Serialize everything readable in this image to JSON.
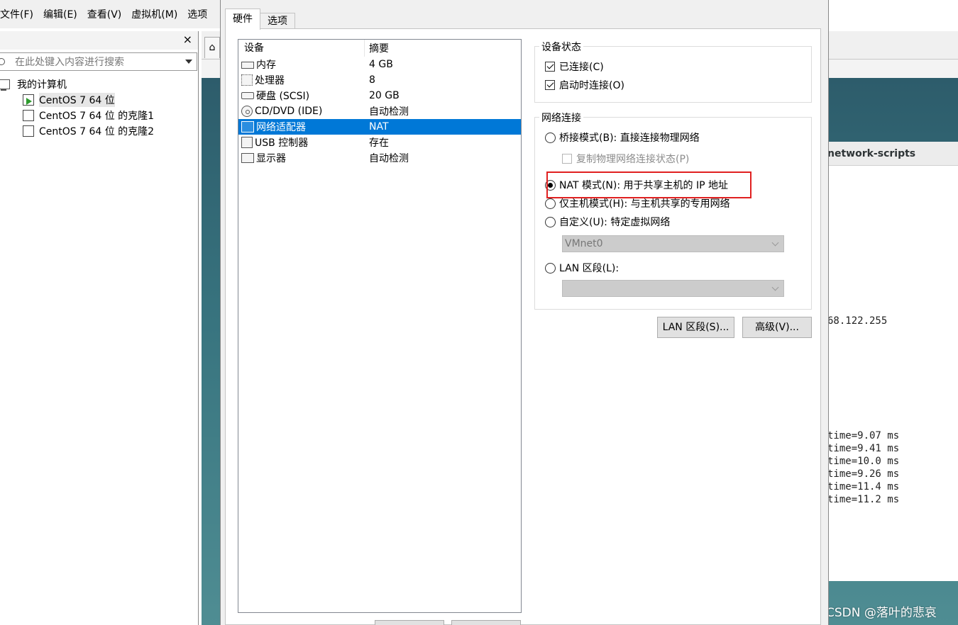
{
  "menubar": {
    "items": [
      "文件(F)",
      "编辑(E)",
      "查看(V)",
      "虚拟机(M)",
      "选项"
    ]
  },
  "library": {
    "close_label": "×",
    "search_placeholder": "在此处键入内容进行搜索",
    "root": "我的计算机",
    "vms": [
      "CentOS 7 64 位",
      "CentOS 7 64 位 的克隆1",
      "CentOS 7 64 位 的克隆2"
    ]
  },
  "dialog": {
    "tabs": [
      "硬件",
      "选项"
    ],
    "device_columns": [
      "设备",
      "摘要"
    ],
    "devices": [
      {
        "name": "内存",
        "summary": "4 GB",
        "icon": "memory-icon"
      },
      {
        "name": "处理器",
        "summary": "8",
        "icon": "cpu-icon"
      },
      {
        "name": "硬盘 (SCSI)",
        "summary": "20 GB",
        "icon": "hard-disk-icon"
      },
      {
        "name": "CD/DVD (IDE)",
        "summary": "自动检测",
        "icon": "cd-dvd-icon"
      },
      {
        "name": "网络适配器",
        "summary": "NAT",
        "icon": "network-adapter-icon"
      },
      {
        "name": "USB 控制器",
        "summary": "存在",
        "icon": "usb-icon"
      },
      {
        "name": "显示器",
        "summary": "自动检测",
        "icon": "display-icon"
      }
    ],
    "device_status": {
      "title": "设备状态",
      "connected": "已连接(C)",
      "connect_on_power": "启动时连接(O)"
    },
    "network": {
      "title": "网络连接",
      "bridged": "桥接模式(B): 直接连接物理网络",
      "replicate": "复制物理网络连接状态(P)",
      "nat": "NAT 模式(N): 用于共享主机的 IP 地址",
      "host_only": "仅主机模式(H): 与主机共享的专用网络",
      "custom": "自定义(U): 特定虚拟网络",
      "custom_value": "VMnet0",
      "lan": "LAN 区段(L):",
      "lan_value": ""
    },
    "buttons": {
      "lan_segments": "LAN 区段(S)...",
      "advanced": "高级(V)..."
    }
  },
  "guest": {
    "window_title": "network-scripts",
    "broadcast": "68.122.255",
    "ping_lines": [
      "time=9.07 ms",
      "time=9.41 ms",
      "time=10.0 ms",
      "time=9.26 ms",
      "time=11.4 ms",
      "time=11.2 ms"
    ]
  },
  "watermark": "CSDN @落叶的悲哀",
  "colors": {
    "selection": "#0078d7",
    "highlight": "#e02020"
  }
}
